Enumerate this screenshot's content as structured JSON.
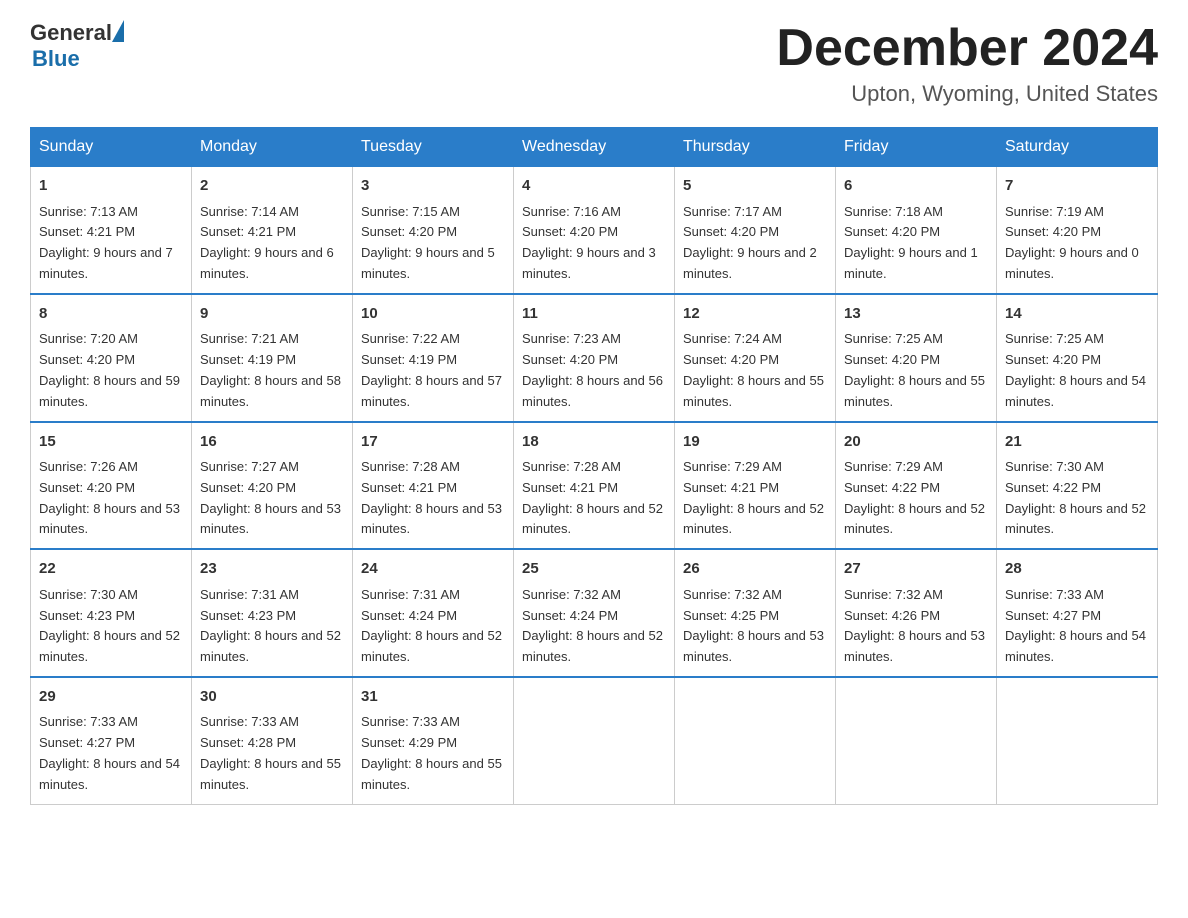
{
  "header": {
    "logo_general": "General",
    "logo_blue": "Blue",
    "title": "December 2024",
    "subtitle": "Upton, Wyoming, United States"
  },
  "days_of_week": [
    "Sunday",
    "Monday",
    "Tuesday",
    "Wednesday",
    "Thursday",
    "Friday",
    "Saturday"
  ],
  "weeks": [
    [
      {
        "day": "1",
        "sunrise": "7:13 AM",
        "sunset": "4:21 PM",
        "daylight": "9 hours and 7 minutes."
      },
      {
        "day": "2",
        "sunrise": "7:14 AM",
        "sunset": "4:21 PM",
        "daylight": "9 hours and 6 minutes."
      },
      {
        "day": "3",
        "sunrise": "7:15 AM",
        "sunset": "4:20 PM",
        "daylight": "9 hours and 5 minutes."
      },
      {
        "day": "4",
        "sunrise": "7:16 AM",
        "sunset": "4:20 PM",
        "daylight": "9 hours and 3 minutes."
      },
      {
        "day": "5",
        "sunrise": "7:17 AM",
        "sunset": "4:20 PM",
        "daylight": "9 hours and 2 minutes."
      },
      {
        "day": "6",
        "sunrise": "7:18 AM",
        "sunset": "4:20 PM",
        "daylight": "9 hours and 1 minute."
      },
      {
        "day": "7",
        "sunrise": "7:19 AM",
        "sunset": "4:20 PM",
        "daylight": "9 hours and 0 minutes."
      }
    ],
    [
      {
        "day": "8",
        "sunrise": "7:20 AM",
        "sunset": "4:20 PM",
        "daylight": "8 hours and 59 minutes."
      },
      {
        "day": "9",
        "sunrise": "7:21 AM",
        "sunset": "4:19 PM",
        "daylight": "8 hours and 58 minutes."
      },
      {
        "day": "10",
        "sunrise": "7:22 AM",
        "sunset": "4:19 PM",
        "daylight": "8 hours and 57 minutes."
      },
      {
        "day": "11",
        "sunrise": "7:23 AM",
        "sunset": "4:20 PM",
        "daylight": "8 hours and 56 minutes."
      },
      {
        "day": "12",
        "sunrise": "7:24 AM",
        "sunset": "4:20 PM",
        "daylight": "8 hours and 55 minutes."
      },
      {
        "day": "13",
        "sunrise": "7:25 AM",
        "sunset": "4:20 PM",
        "daylight": "8 hours and 55 minutes."
      },
      {
        "day": "14",
        "sunrise": "7:25 AM",
        "sunset": "4:20 PM",
        "daylight": "8 hours and 54 minutes."
      }
    ],
    [
      {
        "day": "15",
        "sunrise": "7:26 AM",
        "sunset": "4:20 PM",
        "daylight": "8 hours and 53 minutes."
      },
      {
        "day": "16",
        "sunrise": "7:27 AM",
        "sunset": "4:20 PM",
        "daylight": "8 hours and 53 minutes."
      },
      {
        "day": "17",
        "sunrise": "7:28 AM",
        "sunset": "4:21 PM",
        "daylight": "8 hours and 53 minutes."
      },
      {
        "day": "18",
        "sunrise": "7:28 AM",
        "sunset": "4:21 PM",
        "daylight": "8 hours and 52 minutes."
      },
      {
        "day": "19",
        "sunrise": "7:29 AM",
        "sunset": "4:21 PM",
        "daylight": "8 hours and 52 minutes."
      },
      {
        "day": "20",
        "sunrise": "7:29 AM",
        "sunset": "4:22 PM",
        "daylight": "8 hours and 52 minutes."
      },
      {
        "day": "21",
        "sunrise": "7:30 AM",
        "sunset": "4:22 PM",
        "daylight": "8 hours and 52 minutes."
      }
    ],
    [
      {
        "day": "22",
        "sunrise": "7:30 AM",
        "sunset": "4:23 PM",
        "daylight": "8 hours and 52 minutes."
      },
      {
        "day": "23",
        "sunrise": "7:31 AM",
        "sunset": "4:23 PM",
        "daylight": "8 hours and 52 minutes."
      },
      {
        "day": "24",
        "sunrise": "7:31 AM",
        "sunset": "4:24 PM",
        "daylight": "8 hours and 52 minutes."
      },
      {
        "day": "25",
        "sunrise": "7:32 AM",
        "sunset": "4:24 PM",
        "daylight": "8 hours and 52 minutes."
      },
      {
        "day": "26",
        "sunrise": "7:32 AM",
        "sunset": "4:25 PM",
        "daylight": "8 hours and 53 minutes."
      },
      {
        "day": "27",
        "sunrise": "7:32 AM",
        "sunset": "4:26 PM",
        "daylight": "8 hours and 53 minutes."
      },
      {
        "day": "28",
        "sunrise": "7:33 AM",
        "sunset": "4:27 PM",
        "daylight": "8 hours and 54 minutes."
      }
    ],
    [
      {
        "day": "29",
        "sunrise": "7:33 AM",
        "sunset": "4:27 PM",
        "daylight": "8 hours and 54 minutes."
      },
      {
        "day": "30",
        "sunrise": "7:33 AM",
        "sunset": "4:28 PM",
        "daylight": "8 hours and 55 minutes."
      },
      {
        "day": "31",
        "sunrise": "7:33 AM",
        "sunset": "4:29 PM",
        "daylight": "8 hours and 55 minutes."
      },
      null,
      null,
      null,
      null
    ]
  ]
}
